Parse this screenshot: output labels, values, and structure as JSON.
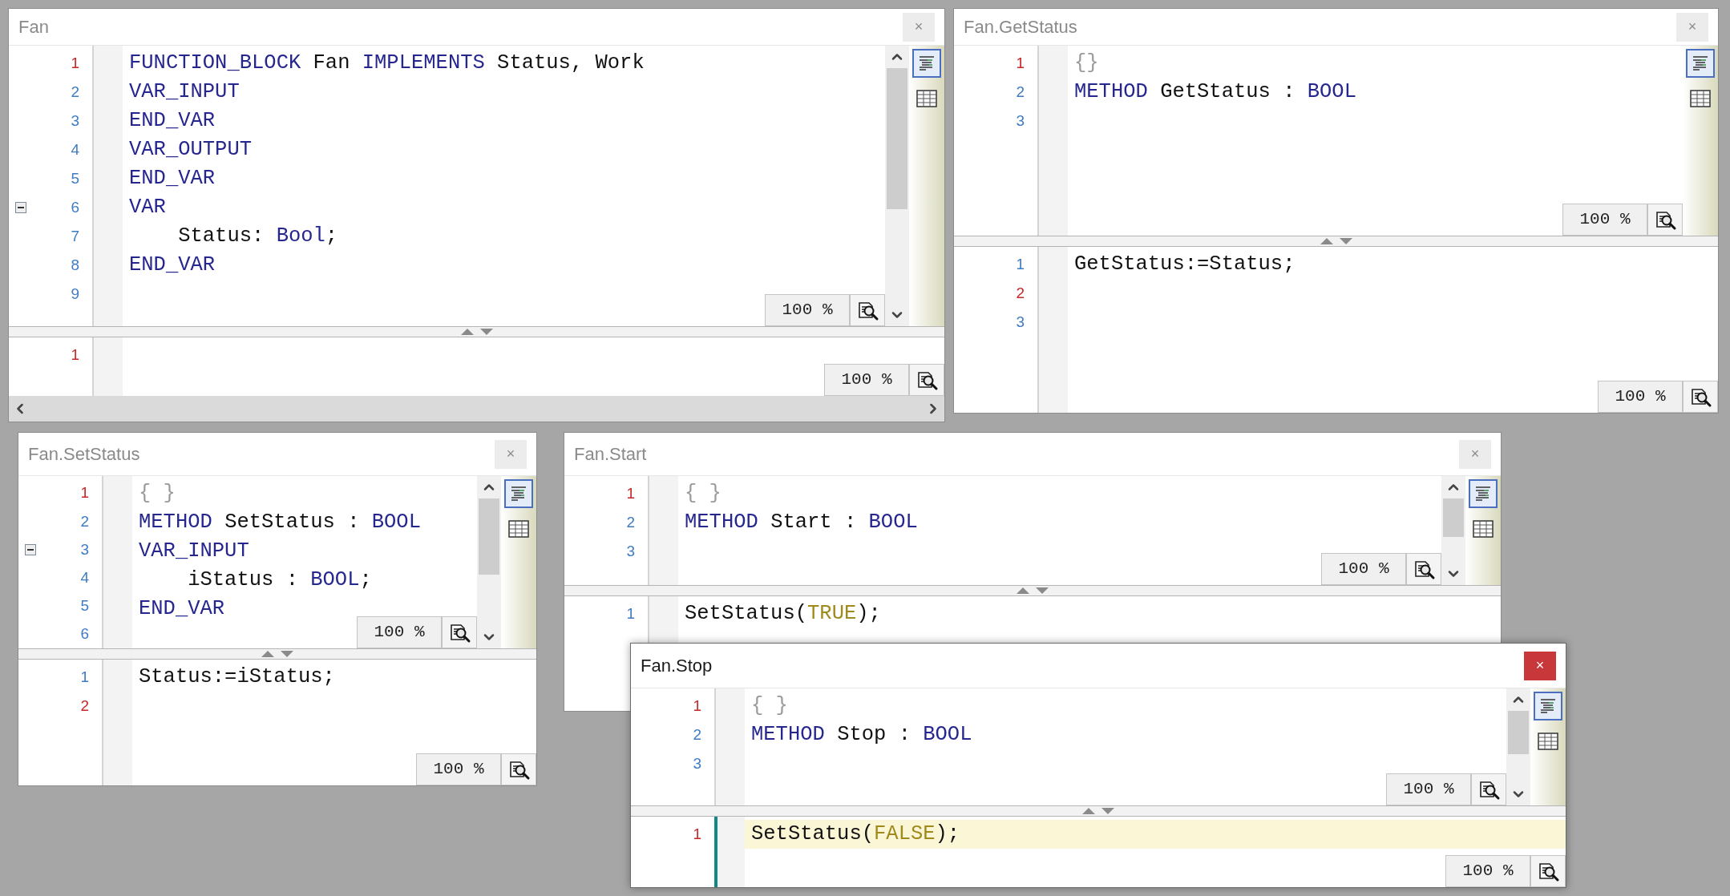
{
  "windows": [
    {
      "title": "Fan",
      "active": false,
      "close": "×",
      "horizontal_scrollbar": true,
      "views": [
        {
          "kind": "text",
          "selected": true
        },
        {
          "kind": "table",
          "selected": false
        }
      ],
      "editor": {
        "scrollbar": true,
        "zoom": "100 %",
        "lines": [
          {
            "n": "1",
            "color": "#c62828",
            "fold": false,
            "current": false,
            "code": [
              {
                "kind": "keyword",
                "text": "FUNCTION_BLOCK"
              },
              {
                "kind": "plain",
                "text": " Fan "
              },
              {
                "kind": "keyword",
                "text": "IMPLEMENTS"
              },
              {
                "kind": "plain",
                "text": " Status, Work"
              }
            ]
          },
          {
            "n": "2",
            "color": "#3f7cc4",
            "fold": false,
            "current": false,
            "code": [
              {
                "kind": "keyword",
                "text": "VAR_INPUT"
              }
            ]
          },
          {
            "n": "3",
            "color": "#3f7cc4",
            "fold": false,
            "current": false,
            "code": [
              {
                "kind": "keyword",
                "text": "END_VAR"
              }
            ]
          },
          {
            "n": "4",
            "color": "#3f7cc4",
            "fold": false,
            "current": false,
            "code": [
              {
                "kind": "keyword",
                "text": "VAR_OUTPUT"
              }
            ]
          },
          {
            "n": "5",
            "color": "#3f7cc4",
            "fold": false,
            "current": false,
            "code": [
              {
                "kind": "keyword",
                "text": "END_VAR"
              }
            ]
          },
          {
            "n": "6",
            "color": "#3f7cc4",
            "fold": true,
            "current": false,
            "code": [
              {
                "kind": "keyword",
                "text": "VAR"
              }
            ]
          },
          {
            "n": "7",
            "color": "#3f7cc4",
            "fold": false,
            "current": false,
            "code": [
              {
                "kind": "plain",
                "text": "    Status: "
              },
              {
                "kind": "keyword",
                "text": "Bool"
              },
              {
                "kind": "plain",
                "text": ";"
              }
            ]
          },
          {
            "n": "8",
            "color": "#3f7cc4",
            "fold": false,
            "current": false,
            "code": [
              {
                "kind": "keyword",
                "text": "END_VAR"
              }
            ]
          },
          {
            "n": "9",
            "color": "#3f7cc4",
            "fold": false,
            "current": false
          }
        ]
      },
      "body": {
        "zoom": "100 %",
        "lines": [
          {
            "n": "1",
            "color": "#c62828",
            "fold": false,
            "current": false
          }
        ]
      }
    },
    {
      "title": "Fan.GetStatus",
      "active": false,
      "close": "×",
      "views": [
        {
          "kind": "text",
          "selected": true
        },
        {
          "kind": "table",
          "selected": false
        }
      ],
      "editor": {
        "zoom": "100 %",
        "lines": [
          {
            "n": "1",
            "color": "#c62828",
            "fold": false,
            "current": false,
            "code": [
              {
                "kind": "pragma",
                "text": "{}"
              }
            ]
          },
          {
            "n": "2",
            "color": "#3f7cc4",
            "fold": false,
            "current": false,
            "code": [
              {
                "kind": "keyword",
                "text": "METHOD"
              },
              {
                "kind": "plain",
                "text": " GetStatus : "
              },
              {
                "kind": "keyword",
                "text": "BOOL"
              }
            ]
          },
          {
            "n": "3",
            "color": "#3f7cc4",
            "fold": false,
            "current": false
          }
        ]
      },
      "body": {
        "zoom": "100 %",
        "lines": [
          {
            "n": "1",
            "color": "#3f7cc4",
            "fold": false,
            "current": false,
            "code": [
              {
                "kind": "plain",
                "text": "GetStatus:=Status;"
              }
            ]
          },
          {
            "n": "2",
            "color": "#c62828",
            "fold": false,
            "current": false
          },
          {
            "n": "3",
            "color": "#3f7cc4",
            "fold": false,
            "current": false
          }
        ]
      }
    },
    {
      "title": "Fan.SetStatus",
      "active": false,
      "close": "×",
      "views": [
        {
          "kind": "text",
          "selected": true
        },
        {
          "kind": "table",
          "selected": false
        }
      ],
      "editor": {
        "scrollbar": true,
        "zoom": "100 %",
        "lines": [
          {
            "n": "1",
            "color": "#c62828",
            "fold": false,
            "current": false,
            "code": [
              {
                "kind": "pragma",
                "text": "{ }"
              }
            ]
          },
          {
            "n": "2",
            "color": "#3f7cc4",
            "fold": false,
            "current": false,
            "code": [
              {
                "kind": "keyword",
                "text": "METHOD"
              },
              {
                "kind": "plain",
                "text": " SetStatus : "
              },
              {
                "kind": "keyword",
                "text": "BOOL"
              }
            ]
          },
          {
            "n": "3",
            "color": "#3f7cc4",
            "fold": true,
            "current": false,
            "code": [
              {
                "kind": "keyword",
                "text": "VAR_INPUT"
              }
            ]
          },
          {
            "n": "4",
            "color": "#3f7cc4",
            "fold": false,
            "current": false,
            "code": [
              {
                "kind": "plain",
                "text": "    iStatus : "
              },
              {
                "kind": "keyword",
                "text": "BOOL"
              },
              {
                "kind": "plain",
                "text": ";"
              }
            ]
          },
          {
            "n": "5",
            "color": "#3f7cc4",
            "fold": false,
            "current": false,
            "code": [
              {
                "kind": "keyword",
                "text": "END_VAR"
              }
            ]
          },
          {
            "n": "6",
            "color": "#3f7cc4",
            "fold": false,
            "current": false
          }
        ]
      },
      "body": {
        "zoom": "100 %",
        "lines": [
          {
            "n": "1",
            "color": "#3f7cc4",
            "fold": false,
            "current": false,
            "code": [
              {
                "kind": "plain",
                "text": "Status:=iStatus;"
              }
            ]
          },
          {
            "n": "2",
            "color": "#c62828",
            "fold": false,
            "current": false
          }
        ]
      }
    },
    {
      "title": "Fan.Start",
      "active": false,
      "close": "×",
      "views": [
        {
          "kind": "text",
          "selected": true
        },
        {
          "kind": "table",
          "selected": false
        }
      ],
      "editor": {
        "scrollbar": true,
        "zoom": "100 %",
        "lines": [
          {
            "n": "1",
            "color": "#c62828",
            "fold": false,
            "current": false,
            "code": [
              {
                "kind": "pragma",
                "text": "{ }"
              }
            ]
          },
          {
            "n": "2",
            "color": "#3f7cc4",
            "fold": false,
            "current": false,
            "code": [
              {
                "kind": "keyword",
                "text": "METHOD"
              },
              {
                "kind": "plain",
                "text": " Start : "
              },
              {
                "kind": "keyword",
                "text": "BOOL"
              }
            ]
          },
          {
            "n": "3",
            "color": "#3f7cc4",
            "fold": false,
            "current": false
          }
        ]
      },
      "body": {
        "lines": [
          {
            "n": "1",
            "color": "#3f7cc4",
            "fold": false,
            "current": false,
            "code": [
              {
                "kind": "plain",
                "text": "SetStatus("
              },
              {
                "kind": "literal",
                "text": "TRUE"
              },
              {
                "kind": "plain",
                "text": ");"
              }
            ]
          }
        ]
      }
    },
    {
      "title": "Fan.Stop",
      "active": true,
      "close": "×",
      "views": [
        {
          "kind": "text",
          "selected": true
        },
        {
          "kind": "table",
          "selected": false
        }
      ],
      "editor": {
        "scrollbar": true,
        "zoom": "100 %",
        "lines": [
          {
            "n": "1",
            "color": "#c62828",
            "fold": false,
            "current": false,
            "code": [
              {
                "kind": "pragma",
                "text": "{ }"
              }
            ]
          },
          {
            "n": "2",
            "color": "#3f7cc4",
            "fold": false,
            "current": false,
            "code": [
              {
                "kind": "keyword",
                "text": "METHOD"
              },
              {
                "kind": "plain",
                "text": " Stop : "
              },
              {
                "kind": "keyword",
                "text": "BOOL"
              }
            ]
          },
          {
            "n": "3",
            "color": "#3f7cc4",
            "fold": false,
            "current": false
          }
        ]
      },
      "body": {
        "zoom": "100 %",
        "lines": [
          {
            "n": "1",
            "color": "#c62828",
            "fold": false,
            "current": true,
            "code": [
              {
                "kind": "plain",
                "text": "SetStatus("
              },
              {
                "kind": "literal",
                "text": "FALSE"
              },
              {
                "kind": "plain",
                "text": ");"
              }
            ]
          }
        ]
      }
    }
  ]
}
